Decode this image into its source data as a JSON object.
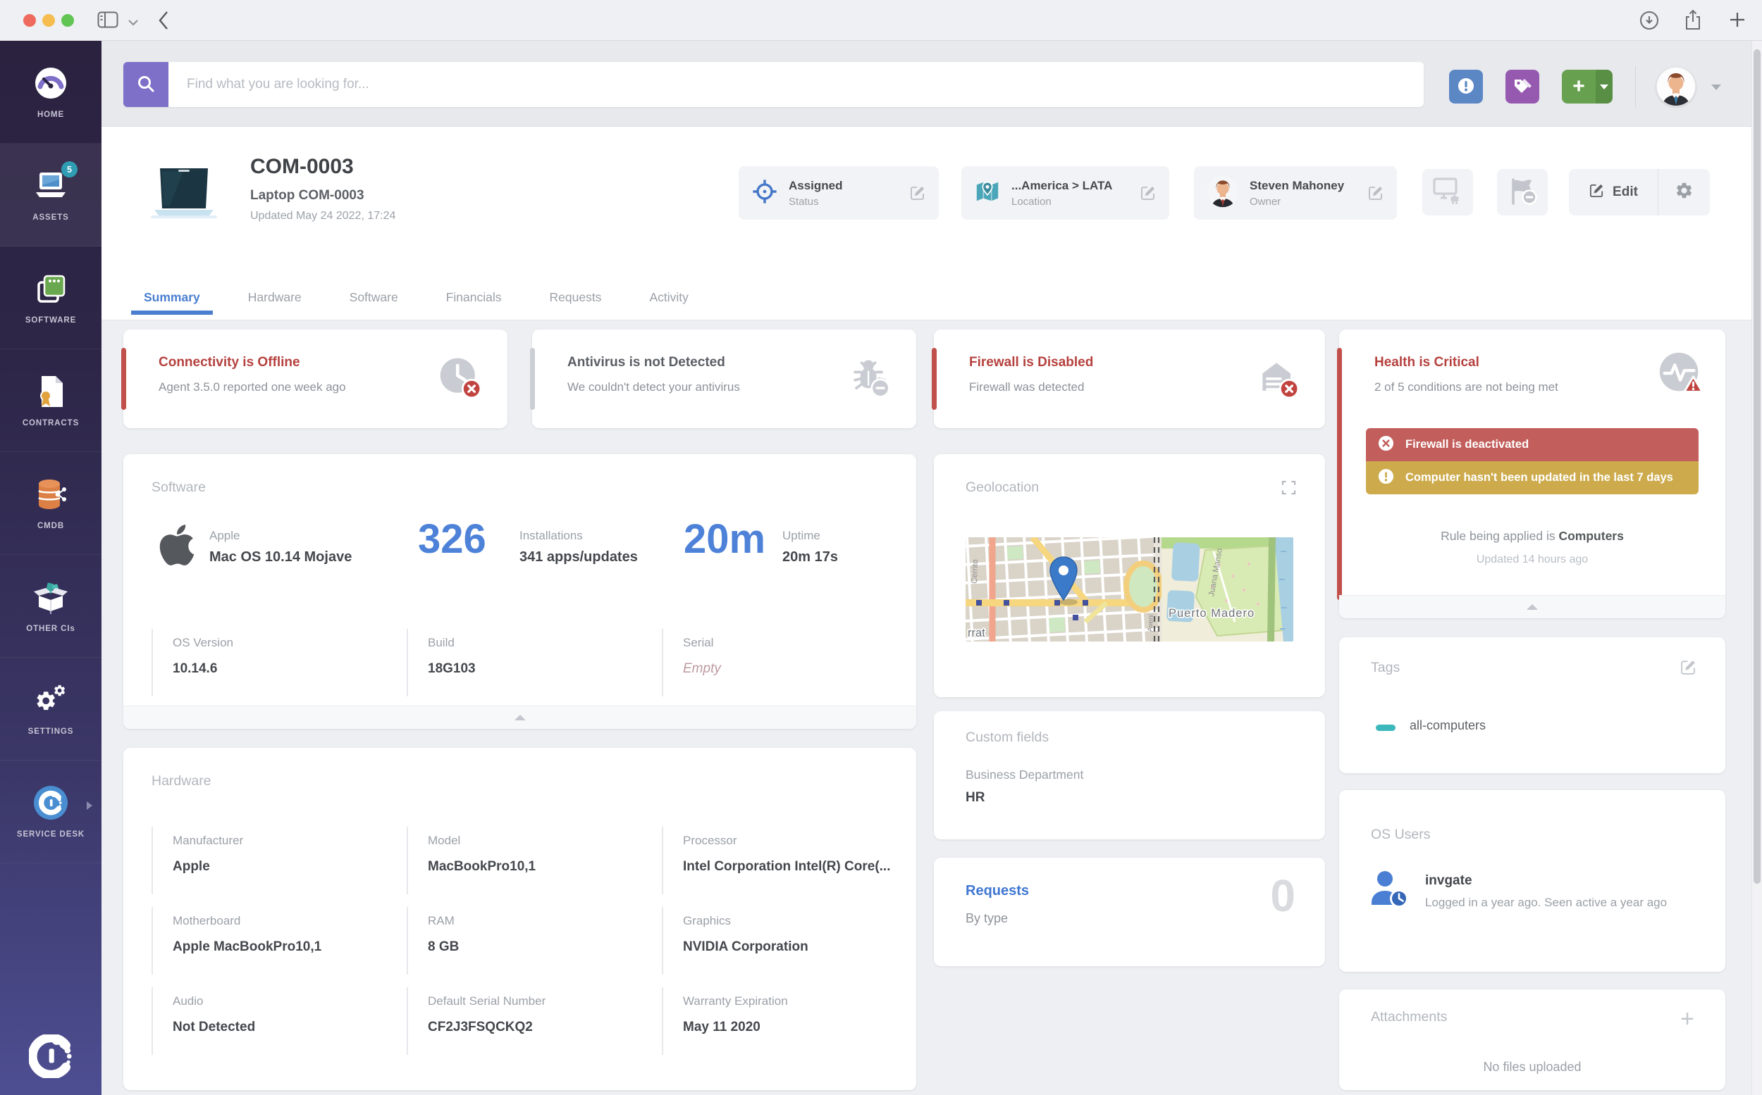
{
  "colors": {
    "accent_blue": "#4a7fd0",
    "alert_red": "#b5413e",
    "banner_red": "#c25e5b",
    "banner_gold": "#cdab4d",
    "tag_teal": "#3cb8bd",
    "search_purple": "#7e6fc9",
    "add_green": "#67a14f",
    "sidebar_top": "#2b2240",
    "sidebar_bottom": "#4d4e92"
  },
  "sidebar": {
    "items": [
      {
        "label": "HOME"
      },
      {
        "label": "ASSETS",
        "badge": "5"
      },
      {
        "label": "SOFTWARE"
      },
      {
        "label": "CONTRACTS"
      },
      {
        "label": "CMDB"
      },
      {
        "label": "OTHER CIs"
      },
      {
        "label": "SETTINGS"
      },
      {
        "label": "SERVICE DESK"
      }
    ]
  },
  "search": {
    "placeholder": "Find what you are looking for..."
  },
  "asset": {
    "id": "COM-0003",
    "subtitle": "Laptop COM-0003",
    "updated": "Updated May 24 2022, 17:24",
    "chips": [
      {
        "value": "Assigned",
        "label": "Status"
      },
      {
        "value": "...America > LATA",
        "label": "Location"
      },
      {
        "value": "Steven Mahoney",
        "label": "Owner"
      }
    ],
    "edit_label": "Edit"
  },
  "tabs": [
    {
      "label": "Summary"
    },
    {
      "label": "Hardware"
    },
    {
      "label": "Software"
    },
    {
      "label": "Financials"
    },
    {
      "label": "Requests"
    },
    {
      "label": "Activity"
    }
  ],
  "alerts": [
    {
      "title": "Connectivity is Offline",
      "description": "Agent 3.5.0 reported one week ago"
    },
    {
      "title": "Antivirus is not Detected",
      "description": "We couldn't detect your antivirus"
    },
    {
      "title": "Firewall is Disabled",
      "description": "Firewall was detected"
    }
  ],
  "health": {
    "title": "Health is Critical",
    "description": "2 of 5 conditions are not being met",
    "issues": [
      {
        "text": "Firewall is deactivated"
      },
      {
        "text": "Computer hasn't been updated in the last 7 days"
      }
    ],
    "rule_prefix": "Rule being applied is ",
    "rule_name": "Computers",
    "updated": "Updated 14 hours ago"
  },
  "software": {
    "title": "Software",
    "os_vendor": "Apple",
    "os_name": "Mac OS 10.14 Mojave",
    "installations_value": "326",
    "installations_label": "Installations",
    "installations_detail": "341 apps/updates",
    "uptime_value": "20m",
    "uptime_label": "Uptime",
    "uptime_detail": "20m 17s",
    "fields": [
      {
        "label": "OS Version",
        "value": "10.14.6"
      },
      {
        "label": "Build",
        "value": "18G103"
      },
      {
        "label": "Serial",
        "value": "Empty"
      }
    ]
  },
  "hardware": {
    "title": "Hardware",
    "fields": [
      {
        "label": "Manufacturer",
        "value": "Apple"
      },
      {
        "label": "Model",
        "value": "MacBookPro10,1"
      },
      {
        "label": "Processor",
        "value": "Intel Corporation Intel(R) Core(..."
      },
      {
        "label": "Motherboard",
        "value": "Apple MacBookPro10,1"
      },
      {
        "label": "RAM",
        "value": "8 GB"
      },
      {
        "label": "Graphics",
        "value": "NVIDIA Corporation"
      },
      {
        "label": "Audio",
        "value": "Not Detected"
      },
      {
        "label": "Default Serial Number",
        "value": "CF2J3FSQCKQ2"
      },
      {
        "label": "Warranty Expiration",
        "value": "May 11 2020"
      }
    ]
  },
  "geolocation": {
    "title": "Geolocation",
    "map_labels": {
      "street_left": "Cerrito",
      "street_right": "Juana Manso",
      "district": "Puerto Madero",
      "corner": "rrat"
    }
  },
  "custom_fields": {
    "title": "Custom fields",
    "fields": [
      {
        "label": "Business Department",
        "value": "HR"
      }
    ]
  },
  "requests": {
    "title": "Requests",
    "subtitle": "By type",
    "count": "0"
  },
  "tags": {
    "title": "Tags",
    "items": [
      {
        "label": "all-computers"
      }
    ]
  },
  "os_users": {
    "title": "OS Users",
    "users": [
      {
        "name": "invgate",
        "activity": "Logged in a year ago. Seen active a year ago"
      }
    ]
  },
  "attachments": {
    "title": "Attachments",
    "empty_text": "No files uploaded"
  }
}
